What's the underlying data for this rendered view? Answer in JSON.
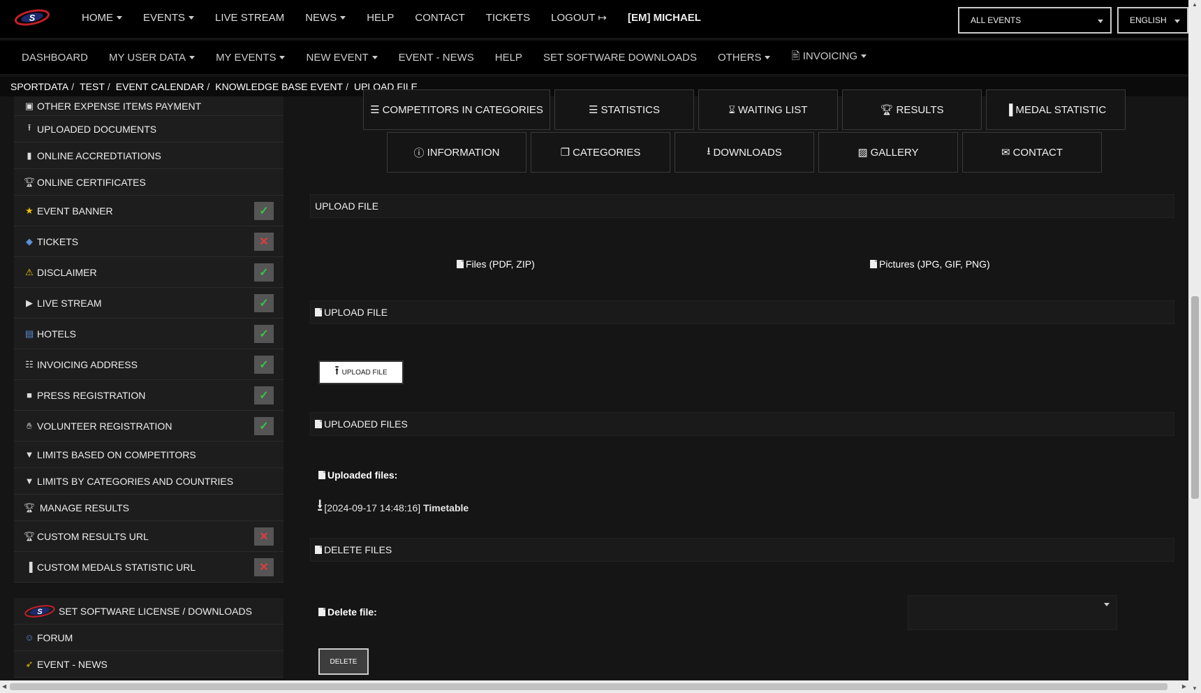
{
  "topnav": {
    "items": [
      "HOME",
      "EVENTS",
      "LIVE STREAM",
      "NEWS",
      "HELP",
      "CONTACT",
      "TICKETS",
      "LOGOUT",
      "[EM] MICHAEL"
    ],
    "event_select": "ALL EVENTS",
    "language_select": "ENGLISH"
  },
  "subnav": {
    "items": [
      "DASHBOARD",
      "MY USER DATA",
      "MY EVENTS",
      "NEW EVENT",
      "EVENT - NEWS",
      "HELP",
      "SET SOFTWARE DOWNLOADS",
      "OTHERS",
      "INVOICING"
    ]
  },
  "breadcrumb": [
    "SPORTDATA",
    "TEST",
    "EVENT CALENDAR",
    "KNOWLEDGE BASE EVENT",
    "UPLOAD FILE"
  ],
  "sidebar": {
    "items": [
      {
        "label": "OTHER EXPENSE ITEMS PAYMENT"
      },
      {
        "label": "UPLOADED DOCUMENTS"
      },
      {
        "label": "ONLINE ACCREDTIATIONS"
      },
      {
        "label": "ONLINE CERTIFICATES"
      },
      {
        "label": "EVENT BANNER",
        "status": "ok"
      },
      {
        "label": "TICKETS",
        "status": "no"
      },
      {
        "label": "DISCLAIMER",
        "status": "ok"
      },
      {
        "label": "LIVE STREAM",
        "status": "ok"
      },
      {
        "label": "HOTELS",
        "status": "ok"
      },
      {
        "label": "INVOICING ADDRESS",
        "status": "ok"
      },
      {
        "label": "PRESS REGISTRATION",
        "status": "ok"
      },
      {
        "label": "VOLUNTEER REGISTRATION",
        "status": "ok"
      },
      {
        "label": "LIMITS BASED ON COMPETITORS"
      },
      {
        "label": "LIMITS BY CATEGORIES AND COUNTRIES"
      },
      {
        "label": "MANAGE RESULTS"
      },
      {
        "label": "CUSTOM RESULTS URL",
        "status": "no"
      },
      {
        "label": "CUSTOM MEDALS STATISTIC URL",
        "status": "no"
      }
    ],
    "bottom_items": [
      "SET SOFTWARE LICENSE / DOWNLOADS",
      "FORUM",
      "EVENT - NEWS"
    ]
  },
  "tiles": {
    "row1": [
      "COMPETITORS IN CATEGORIES",
      "STATISTICS",
      "WAITING LIST",
      "RESULTS",
      "MEDAL STATISTIC"
    ],
    "row2": [
      "INFORMATION",
      "CATEGORIES",
      "DOWNLOADS",
      "GALLERY",
      "CONTACT"
    ]
  },
  "upload": {
    "panel1_title": "UPLOAD FILE",
    "link_files": "Files (PDF, ZIP)",
    "link_pictures": "Pictures (JPG, GIF, PNG)",
    "panel2_title": "UPLOAD FILE",
    "upload_button": "UPLOAD FILE",
    "panel3_title": "UPLOADED FILES",
    "uploaded_label": "Uploaded files:",
    "file_timestamp": "[2024-09-17 14:48:16]",
    "file_name": "Timetable",
    "panel4_title": "DELETE FILES",
    "delete_label": "Delete file:",
    "delete_button": "DELETE"
  },
  "colors": {
    "ok": "#36c24a",
    "no": "#e23b3b",
    "accent": "#f2c200"
  }
}
